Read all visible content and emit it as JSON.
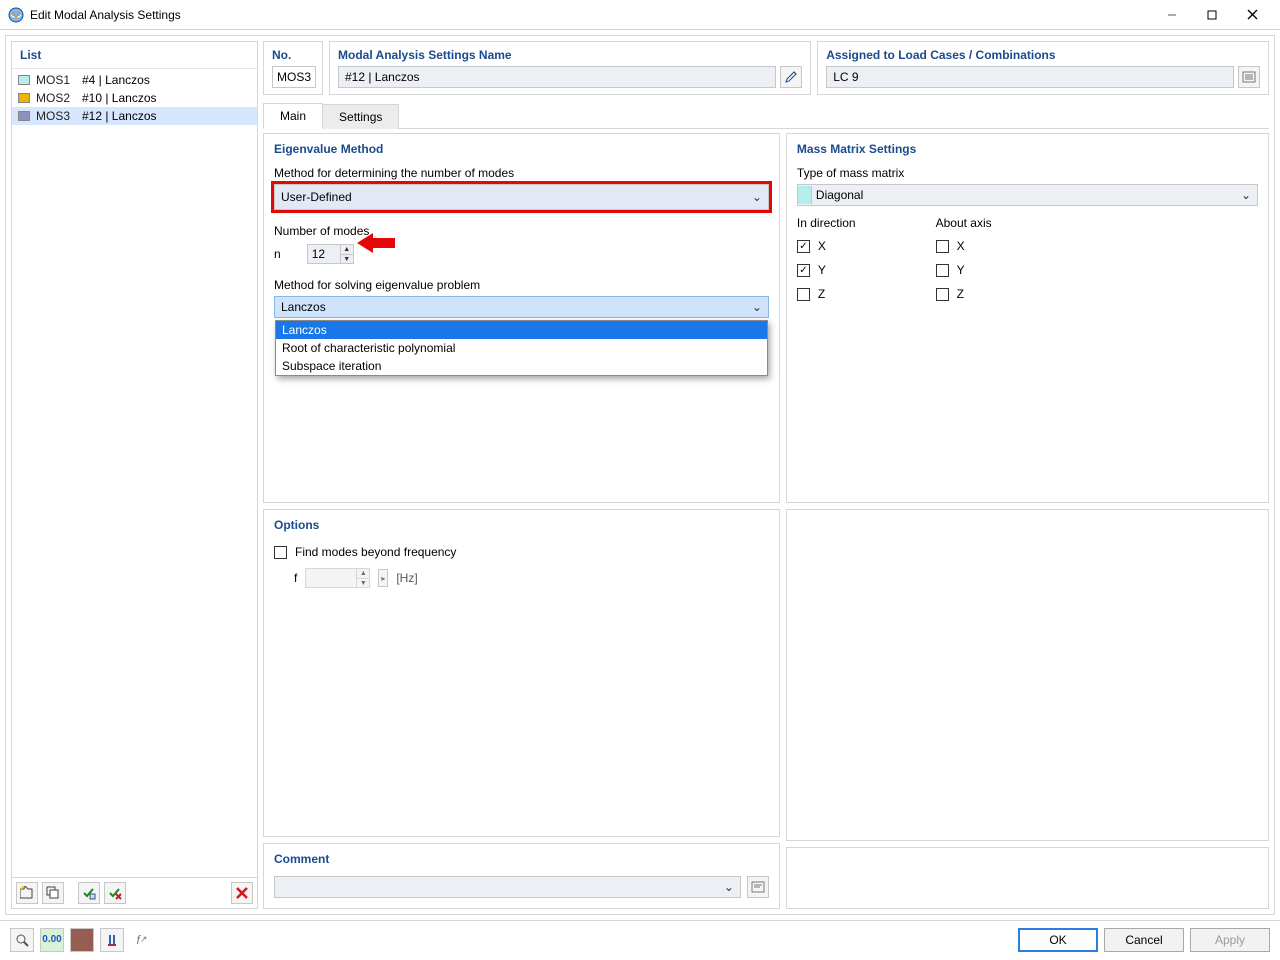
{
  "window": {
    "title": "Edit Modal Analysis Settings"
  },
  "list": {
    "header": "List",
    "items": [
      {
        "code": "MOS1",
        "label": "#4 | Lanczos",
        "color": "#b5ecec"
      },
      {
        "code": "MOS2",
        "label": "#10 | Lanczos",
        "color": "#f0b400"
      },
      {
        "code": "MOS3",
        "label": "#12 | Lanczos",
        "color": "#8f8fc0",
        "selected": true
      }
    ]
  },
  "top": {
    "no_label": "No.",
    "no_value": "MOS3",
    "name_label": "Modal Analysis Settings Name",
    "name_value": "#12 | Lanczos",
    "assigned_label": "Assigned to Load Cases / Combinations",
    "assigned_value": "LC 9"
  },
  "tabs": {
    "main": "Main",
    "settings": "Settings"
  },
  "eigen": {
    "group_title": "Eigenvalue Method",
    "method_label": "Method for determining the number of modes",
    "method_value": "User-Defined",
    "num_modes_label": "Number of modes",
    "num_modes_symbol": "n",
    "num_modes_value": "12",
    "solve_label": "Method for solving eigenvalue problem",
    "solve_value": "Lanczos",
    "solve_options": [
      "Lanczos",
      "Root of characteristic polynomial",
      "Subspace iteration"
    ],
    "solve_selected_index": 0
  },
  "options": {
    "group_title": "Options",
    "find_modes_label": "Find modes beyond frequency",
    "freq_symbol": "f",
    "freq_value": "",
    "freq_unit": "[Hz]"
  },
  "comment": {
    "group_title": "Comment",
    "value": ""
  },
  "mass": {
    "group_title": "Mass Matrix Settings",
    "type_label": "Type of mass matrix",
    "type_value": "Diagonal",
    "dir_heading": "In direction",
    "axis_heading": "About axis",
    "dir": {
      "x": "X",
      "y": "Y",
      "z": "Z"
    },
    "dir_checked": {
      "x": true,
      "y": true,
      "z": false
    },
    "axis": {
      "x": "X",
      "y": "Y",
      "z": "Z"
    },
    "axis_checked": {
      "x": false,
      "y": false,
      "z": false
    }
  },
  "footer": {
    "ok": "OK",
    "cancel": "Cancel",
    "apply": "Apply"
  }
}
